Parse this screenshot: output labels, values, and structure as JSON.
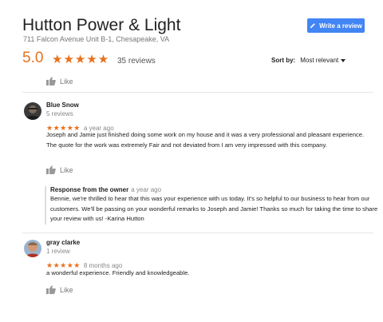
{
  "business": {
    "name": "Hutton Power & Light",
    "address": "711 Falcon Avenue Unit B-1, Chesapeake, VA"
  },
  "actions": {
    "write_review": "Write a review"
  },
  "summary": {
    "rating": "5.0",
    "stars": "★★★★★",
    "review_count": "35 reviews",
    "sort_label": "Sort by:",
    "sort_value": "Most relevant"
  },
  "like_label": "Like",
  "reviews": [
    {
      "name": "Blue Snow",
      "meta": "5 reviews",
      "stars": "★★★★★",
      "time": "a year ago",
      "text": "Joseph and Jamie just finished doing some work on my house and it was a very professional and pleasant experience. The quote for the work was extremely Fair and not deviated from I am very impressed with this company.",
      "response": {
        "label": "Response from the owner",
        "time": "a year ago",
        "text": "Bennie, we're thrilled to hear that this was your experience with us today. It's so helpful to our business to hear from our customers. We'll be passing on your wonderful remarks to Joseph and Jamie! Thanks so much for taking the time to share your review with us! -Karina Hutton"
      }
    },
    {
      "name": "gray clarke",
      "meta": "1 review",
      "stars": "★★★★★",
      "time": "8 months ago",
      "text": "a wonderful experience. Friendly and knowledgeable."
    }
  ],
  "colors": {
    "accent": "#e7711b",
    "button": "#4285f4"
  },
  "icons": {
    "like": "thumbs-up-icon",
    "write": "pencil-icon"
  }
}
